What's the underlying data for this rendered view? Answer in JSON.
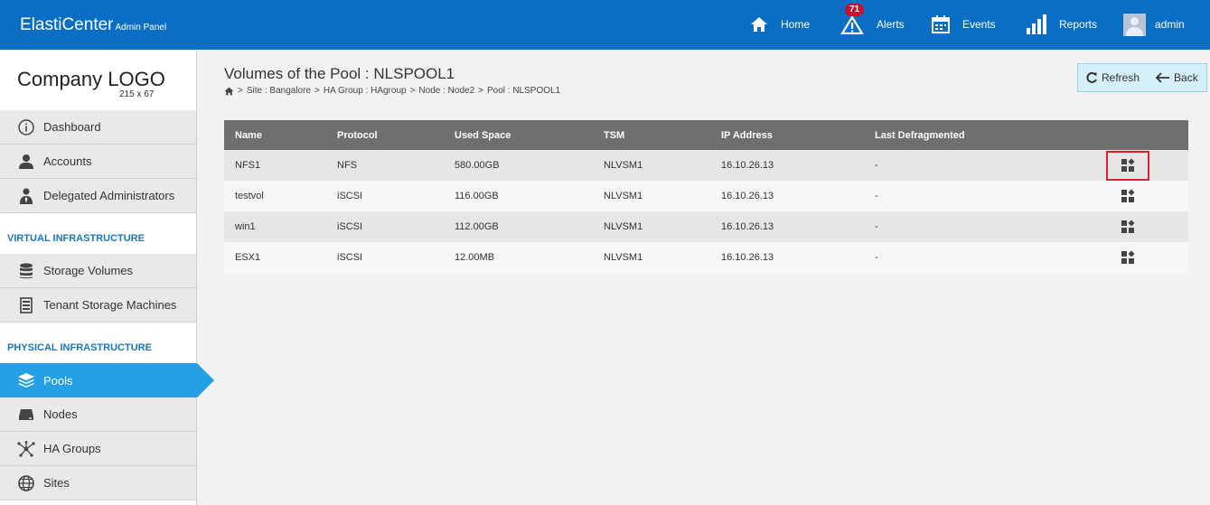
{
  "header": {
    "brand": "ElastiCenter",
    "brand_sub": "Admin Panel",
    "nav": {
      "home": "Home",
      "alerts": "Alerts",
      "alerts_count": "71",
      "events": "Events",
      "reports": "Reports",
      "user": "admin"
    }
  },
  "sidebar": {
    "logo": "Company LOGO",
    "logo_size": "215 x 67",
    "items": [
      {
        "label": "Dashboard",
        "icon": "info-icon"
      },
      {
        "label": "Accounts",
        "icon": "user-icon"
      },
      {
        "label": "Delegated Administrators",
        "icon": "admin-icon"
      }
    ],
    "section_virtual": "VIRTUAL INFRASTRUCTURE",
    "virtual_items": [
      {
        "label": "Storage Volumes",
        "icon": "database-icon"
      },
      {
        "label": "Tenant Storage Machines",
        "icon": "server-icon"
      }
    ],
    "section_physical": "PHYSICAL INFRASTRUCTURE",
    "physical_items": [
      {
        "label": "Pools",
        "icon": "layers-icon",
        "active": true
      },
      {
        "label": "Nodes",
        "icon": "drive-icon"
      },
      {
        "label": "HA Groups",
        "icon": "network-icon"
      },
      {
        "label": "Sites",
        "icon": "globe-icon"
      }
    ]
  },
  "main": {
    "title": "Volumes of the Pool : NLSPOOL1",
    "breadcrumb": [
      "Site : Bangalore",
      "HA Group : HAgroup",
      "Node : Node2",
      "Pool : NLSPOOL1"
    ],
    "refresh_label": "Refresh",
    "back_label": "Back",
    "table": {
      "headers": [
        "Name",
        "Protocol",
        "Used Space",
        "TSM",
        "IP Address",
        "Last Defragmented"
      ],
      "rows": [
        [
          "NFS1",
          "NFS",
          "580.00GB",
          "NLVSM1",
          "16.10.26.13",
          "-"
        ],
        [
          "testvol",
          "iSCSI",
          "116.00GB",
          "NLVSM1",
          "16.10.26.13",
          "-"
        ],
        [
          "win1",
          "iSCSI",
          "112.00GB",
          "NLVSM1",
          "16.10.26.13",
          "-"
        ],
        [
          "ESX1",
          "iSCSI",
          "12.00MB",
          "NLVSM1",
          "16.10.26.13",
          "-"
        ]
      ]
    }
  },
  "colors": {
    "topbar": "#0a6fc4",
    "active": "#23a0e6",
    "section": "#1a76c0",
    "badge": "#c8102e",
    "highlight": "#e0202a"
  }
}
